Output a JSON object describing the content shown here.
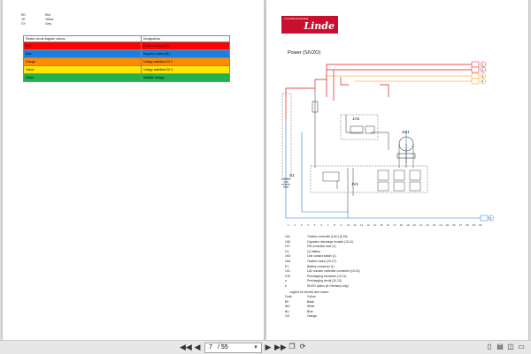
{
  "left_page": {
    "color_codes": [
      {
        "code": "RD",
        "name": "Red"
      },
      {
        "code": "YE",
        "name": "Yellow"
      },
      {
        "code": "GY",
        "name": "Grey"
      }
    ],
    "table": {
      "headers": [
        "Electric circuit diagram colours",
        "Designations"
      ],
      "rows": [
        {
          "colour": "Red",
          "designation": "Positive battery (B+)",
          "bg": "#ff0000"
        },
        {
          "colour": "Blue",
          "designation": "Negative battery (B-)",
          "bg": "#1a7fe0"
        },
        {
          "colour": "Orange",
          "designation": "Voltage stabilised 15 V",
          "bg": "#ff8c00"
        },
        {
          "colour": "Yellow",
          "designation": "Voltage stabilised 10 V",
          "bg": "#ffe600"
        },
        {
          "colour": "Green",
          "designation": "Variable voltage",
          "bg": "#22b14c"
        }
      ]
    }
  },
  "right_page": {
    "logo": {
      "tagline": "Linde Material Handling",
      "brand": "Linde"
    },
    "title": "Power (SIVZO)",
    "schematic_labels": {
      "a6": "1A6",
      "m1": "1M1",
      "g1": "G1",
      "v1": "1V1",
      "markers": [
        "1",
        "2",
        "3",
        "4"
      ],
      "marker_bottom": "5",
      "ruler": [
        "1",
        "2",
        "3",
        "4",
        "5",
        "6",
        "7",
        "8",
        "9",
        "10",
        "11",
        "12",
        "13",
        "14",
        "15",
        "16",
        "17",
        "18",
        "19",
        "20",
        "21",
        "22",
        "23",
        "24",
        "25",
        "26",
        "27",
        "28",
        "29",
        "30"
      ]
    },
    "component_legend": [
      {
        "k": "1A1",
        "v": "Traction controller (LAC) (5-20)"
      },
      {
        "k": "1A6",
        "v": "Capacitor discharge module (10-11)"
      },
      {
        "k": "1F1",
        "v": "200-A traction fuse (1)"
      },
      {
        "k": "G1",
        "v": "(1) battery"
      },
      {
        "k": "1K5",
        "v": "Line contact switch (1)"
      },
      {
        "k": "1M1",
        "v": "Traction motor (20-27)"
      },
      {
        "k": "P1",
        "v": "Battery connector (1)"
      },
      {
        "k": "1X1",
        "v": "LAC traction controller connector (10-15)"
      },
      {
        "k": "X10",
        "v": "Precharging connector (10-11)"
      },
      {
        "k": "a",
        "v": "Precharging circuit (10-13)"
      },
      {
        "k": "b",
        "v": "SIVZO option (in Germany only)"
      }
    ],
    "wire_legend": {
      "title": "Legend for electric wire codes:",
      "rows": [
        {
          "k": "Code",
          "v": "Colour"
        },
        {
          "k": "BK",
          "v": "Black"
        },
        {
          "k": "WH",
          "v": "White"
        },
        {
          "k": "BU",
          "v": "Blue"
        },
        {
          "k": "OG",
          "v": "Orange"
        }
      ]
    }
  },
  "toolbar": {
    "first_icon": "first-page-icon",
    "prev_icon": "prev-page-icon",
    "current_page": "7",
    "total_pages": "/ 55",
    "next_icon": "next-page-icon",
    "last_icon": "last-page-icon",
    "colors": {
      "red": "#ff0000",
      "blue": "#1a7fe0",
      "orange": "#ff8c00",
      "green": "#22b14c",
      "brand": "#c8102e"
    }
  }
}
